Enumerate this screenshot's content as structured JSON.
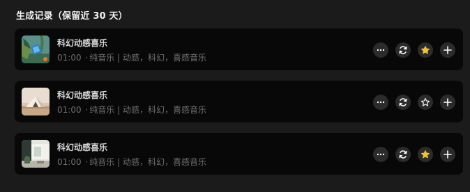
{
  "section": {
    "title": "生成记录（保留近 30 天）"
  },
  "colors": {
    "background": "#1b1b1b",
    "card": "#080808",
    "star_active": "#f2c12e",
    "icon": "#ffffff",
    "button_bg": "#2b2b2b"
  },
  "records": [
    {
      "title": "科幻动感喜乐",
      "duration": "01:00",
      "dot": "·",
      "type": "纯音乐",
      "divider": "|",
      "tags": "动感，科幻，喜感音乐",
      "thumbnail": "tropical-scene",
      "favorited": true,
      "actions": [
        "more-icon",
        "regenerate-icon",
        "star-icon",
        "plus-icon"
      ]
    },
    {
      "title": "科幻动感喜乐",
      "duration": "01:00",
      "dot": "·",
      "type": "纯音乐",
      "divider": "|",
      "tags": "动感，科幻，喜感音乐",
      "thumbnail": "desert-tent",
      "favorited": false,
      "actions": [
        "more-icon",
        "regenerate-icon",
        "star-icon",
        "plus-icon"
      ]
    },
    {
      "title": "科幻动感喜乐",
      "duration": "01:00",
      "dot": "·",
      "type": "纯音乐",
      "divider": "|",
      "tags": "动感，科幻，喜感音乐",
      "thumbnail": "minimal-room",
      "favorited": true,
      "actions": [
        "more-icon",
        "regenerate-icon",
        "star-icon",
        "plus-icon"
      ]
    }
  ]
}
